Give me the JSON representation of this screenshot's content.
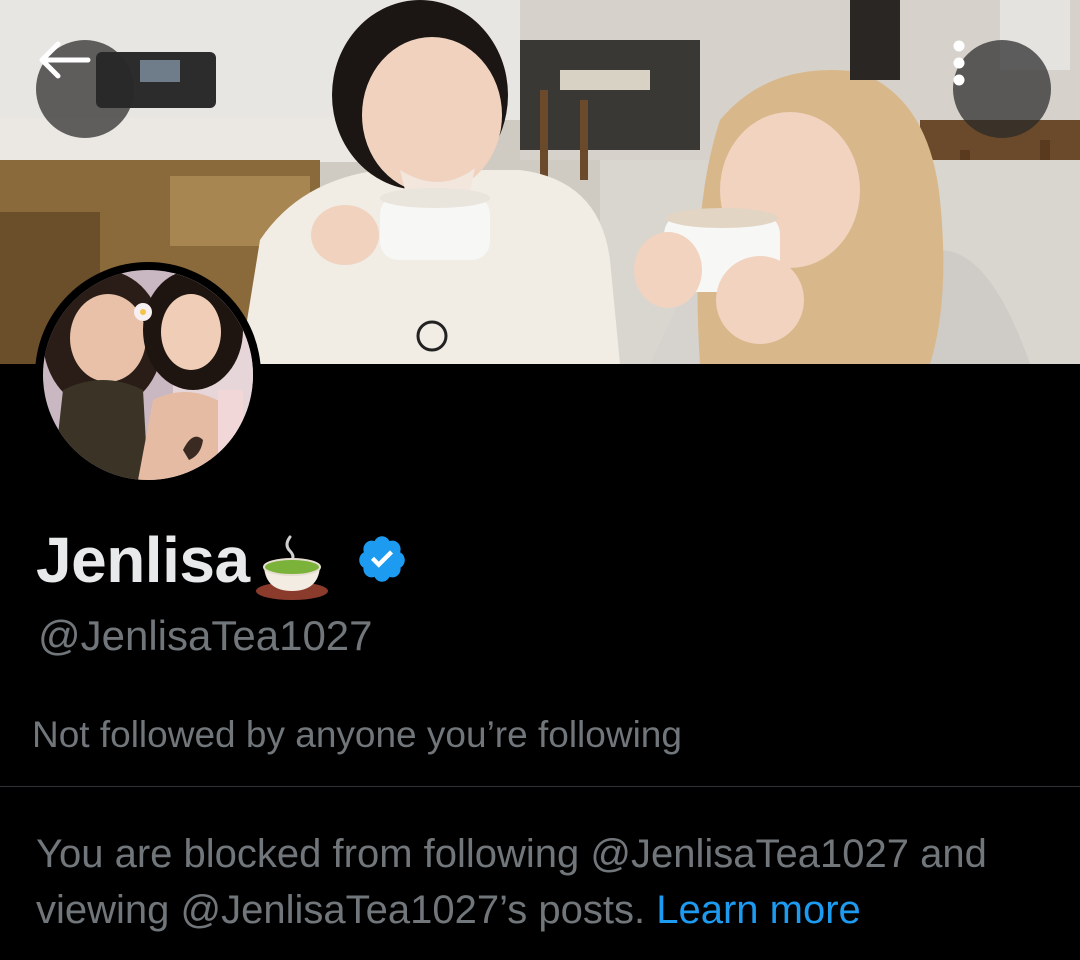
{
  "profile": {
    "display_name": "Jenlisa",
    "handle": "@JenlisaTea1027",
    "verified": true,
    "followers_note": "Not followed by anyone you’re following"
  },
  "blocked_notice": {
    "line": "You are blocked from following @JenlisaTea1027 and viewing @JenlisaTea1027’s posts.",
    "learn_more": "Learn more"
  },
  "icons": {
    "back": "arrow-left-icon",
    "more": "more-vertical-icon",
    "verified": "verified-badge-icon",
    "tea": "tea-cup-emoji"
  },
  "colors": {
    "background": "#000000",
    "primary_text": "#e7e9ea",
    "secondary_text": "#71767b",
    "link": "#1d9bf0",
    "divider": "#2f3336",
    "verified_blue": "#1d9bf0"
  }
}
